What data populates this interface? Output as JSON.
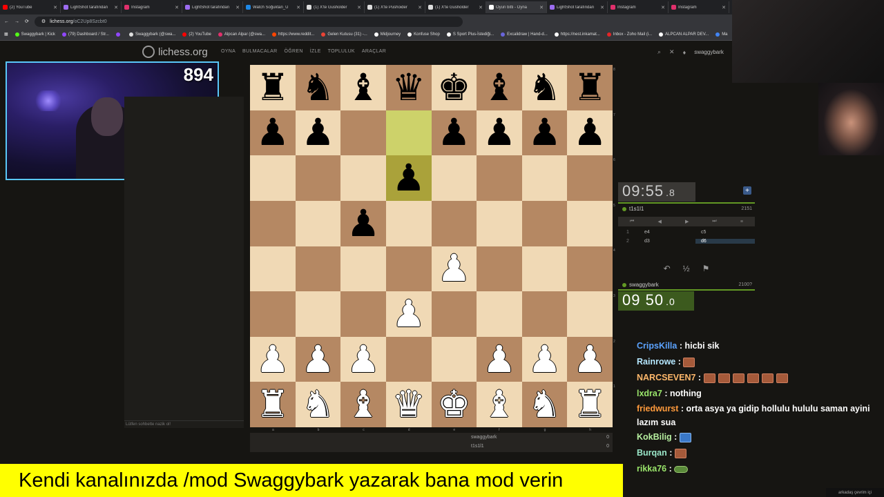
{
  "browser": {
    "tabs": [
      {
        "title": "(2) YouTube",
        "fav": "#ff0000"
      },
      {
        "title": "LightShot tarafından",
        "fav": "#9c6cf0"
      },
      {
        "title": "Instagram",
        "fav": "#e1306c"
      },
      {
        "title": "LightShot tarafından",
        "fav": "#9c6cf0"
      },
      {
        "title": "Watch Soğuktan_Ü",
        "fav": "#1e88e5"
      },
      {
        "title": "(1) X'te Gusholder",
        "fav": "#dddddd"
      },
      {
        "title": "(1) X'te Pushoider",
        "fav": "#dddddd"
      },
      {
        "title": "(1) X'te Gusholder",
        "fav": "#dddddd"
      },
      {
        "title": "Oyun bitti - Oyna",
        "fav": "#ffffff"
      },
      {
        "title": "LightShot tarafından",
        "fav": "#9c6cf0"
      },
      {
        "title": "Instagram",
        "fav": "#e1306c"
      },
      {
        "title": "Instagram",
        "fav": "#e1306c"
      }
    ],
    "url_host": "lichess.org",
    "url_path": "/oC2Up8Szcbt0",
    "bookmarks": [
      {
        "label": "Swaggybark | Kick",
        "fav": "#53fc18"
      },
      {
        "label": "(79) Dashboard / Str...",
        "fav": "#9147ff"
      },
      {
        "label": "",
        "fav": "#9147ff"
      },
      {
        "label": "Swaggybark (@swa...",
        "fav": "#dddddd"
      },
      {
        "label": "(2) YouTube",
        "fav": "#ff0000"
      },
      {
        "label": "Alpcan Alpar (@swa...",
        "fav": "#e1306c"
      },
      {
        "label": "https://www.reddit...",
        "fav": "#ff4500"
      },
      {
        "label": "Gelen Kutusu (31) -...",
        "fav": "#ea4335"
      },
      {
        "label": "Midjourney",
        "fav": "#ffffff"
      },
      {
        "label": "Konfuse Shop",
        "fav": "#ffffff"
      },
      {
        "label": "S Sport Plus-İstediği...",
        "fav": "#ffffff"
      },
      {
        "label": "Excalidraw | Hand-d...",
        "fav": "#6965db"
      },
      {
        "label": "https://nest.inkamat...",
        "fav": "#ffffff"
      },
      {
        "label": "Inbox - Zoho Mail (i...",
        "fav": "#e42527"
      },
      {
        "label": "ALPCAN ALPAR DEV...",
        "fav": "#ffffff"
      },
      {
        "label": "Ma",
        "fav": "#4285f4"
      }
    ]
  },
  "lichess": {
    "logo": "lichess.org",
    "nav": [
      "OYNA",
      "BULMACALAR",
      "ÖĞREN",
      "İZLE",
      "TOPLULUK",
      "ARAÇLAR"
    ],
    "username": "swaggybark",
    "chat_note": "Lütfen sohbette nazik ol!"
  },
  "webcam": {
    "counter": "894"
  },
  "board": {
    "ranks": [
      [
        "r",
        "n",
        "b",
        "q",
        "k",
        "b",
        "n",
        "r"
      ],
      [
        "p",
        "p",
        "",
        "",
        "p",
        "p",
        "p",
        "p"
      ],
      [
        "",
        "",
        "",
        "p",
        "",
        "",
        "",
        ""
      ],
      [
        "",
        "",
        "p",
        "",
        "",
        "",
        "",
        ""
      ],
      [
        "",
        "",
        "",
        "",
        "P",
        "",
        "",
        ""
      ],
      [
        "",
        "",
        "",
        "P",
        "",
        "",
        "",
        ""
      ],
      [
        "P",
        "P",
        "P",
        "",
        "",
        "P",
        "P",
        "P"
      ],
      [
        "R",
        "N",
        "B",
        "Q",
        "K",
        "B",
        "N",
        "R"
      ]
    ],
    "last_move": [
      "d7",
      "d6"
    ],
    "rank_labels": [
      "8",
      "7",
      "6",
      "5",
      "4",
      "3",
      "2",
      "1"
    ],
    "file_labels": [
      "a",
      "b",
      "c",
      "d",
      "e",
      "f",
      "g",
      "h"
    ]
  },
  "game": {
    "top_clock": {
      "main": "09:55",
      "ms": ".8"
    },
    "top_player": {
      "name": "t1s1l1",
      "rating": "2151"
    },
    "bottom_clock": {
      "main": "09 50",
      "ms": ".0"
    },
    "bottom_player": {
      "name": "swaggybark",
      "rating": "2100?"
    },
    "moves": [
      {
        "n": "1",
        "w": "e4",
        "b": "c5"
      },
      {
        "n": "2",
        "w": "d3",
        "b": "d6"
      }
    ],
    "controls": [
      "⏮",
      "◀",
      "▶",
      "⏭",
      "≡"
    ],
    "actions": [
      "↶",
      "½",
      "⚑"
    ],
    "result_rows": [
      {
        "name": "swaggybark",
        "score": "0"
      },
      {
        "name": "t1s1l1",
        "score": "0"
      }
    ]
  },
  "chat": [
    {
      "user": "CripsKilla",
      "color": "#5ba3ff",
      "text": "hicbi sik",
      "emotes": []
    },
    {
      "user": "Rainrowe",
      "color": "#b5e7ff",
      "text": "",
      "emotes": [
        "red"
      ]
    },
    {
      "user": "NARCSEVEN7",
      "color": "#ffb86b",
      "text": "",
      "emotes": [
        "red",
        "red",
        "red",
        "red",
        "red",
        "red"
      ]
    },
    {
      "user": "lxdra7",
      "color": "#9ae66b",
      "text": "nothing",
      "emotes": []
    },
    {
      "user": "friedwurst",
      "color": "#ff9a3c",
      "text": "orta asya ya gidip hollulu hululu saman ayini lazım sua",
      "emotes": []
    },
    {
      "user": "KokBilig",
      "color": "#b7f0a0",
      "text": "",
      "emotes": [
        "blue"
      ]
    },
    {
      "user": "Burqan",
      "color": "#9ae6c8",
      "text": "",
      "emotes": [
        "red"
      ]
    },
    {
      "user": "rikka76",
      "color": "#9ae66b",
      "text": "",
      "emotes": [
        "green"
      ]
    }
  ],
  "chat_footer": "arkadaş çevrim içi",
  "banner": "Kendi kanalınızda /mod Swaggybark yazarak bana mod verin"
}
